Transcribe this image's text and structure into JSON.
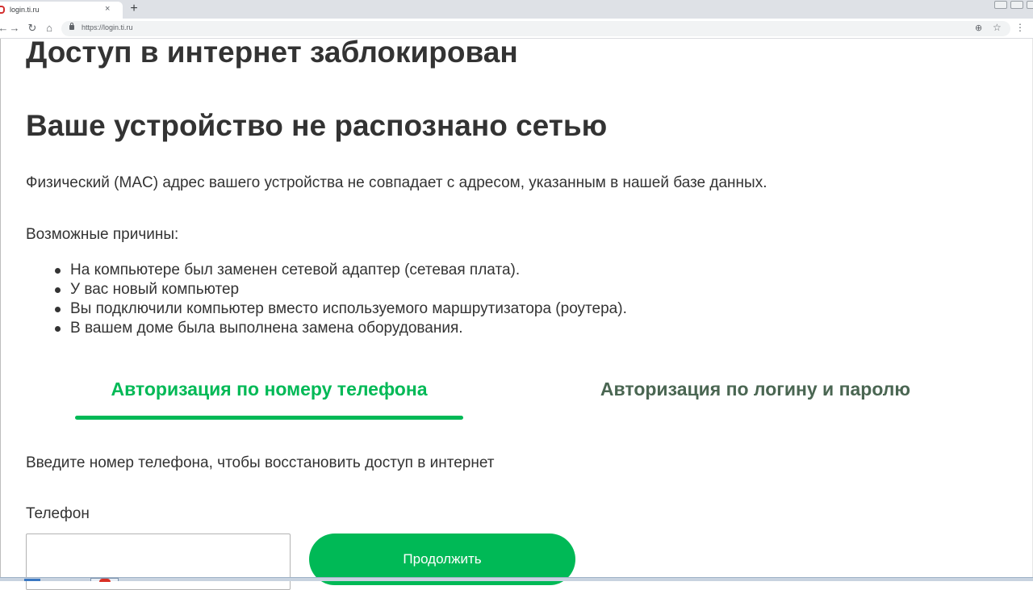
{
  "browser": {
    "tab_title": "login.ti.ru",
    "tab_close": "×",
    "new_tab": "+",
    "url": "https://login.ti.ru",
    "icons": {
      "back": "back-arrow-icon",
      "forward": "forward-arrow-icon",
      "reload": "reload-icon",
      "home": "home-icon",
      "lock": "lock-icon",
      "zoom": "zoom-icon",
      "bookmark": "star-icon",
      "menu": "kebab-menu-icon"
    }
  },
  "page": {
    "heading": "Доступ в интернет заблокирован",
    "subheading": "Ваше устройство не распознано сетью",
    "mac_text": "Физический (MAC) адрес вашего устройства не совпадает с адресом, указанным в нашей базе данных.",
    "reasons_title": "Возможные причины:",
    "reasons": [
      "На компьютере был заменен сетевой адаптер (сетевая плата).",
      "У вас новый компьютер",
      "Вы подключили компьютер вместо используемого маршрутизатора (роутера).",
      "В вашем доме была выполнена замена оборудования."
    ],
    "tabs": {
      "phone": "Авторизация по номеру телефона",
      "login": "Авторизация по логину и паролю",
      "active": "phone"
    },
    "instruction": "Введите номер телефона, чтобы восстановить доступ в интернет",
    "phone_label": "Телефон",
    "phone_value": "",
    "continue_label": "Продолжить"
  },
  "colors": {
    "accent_green": "#00b956",
    "inactive_tab": "#4a6652",
    "text": "#333333"
  }
}
